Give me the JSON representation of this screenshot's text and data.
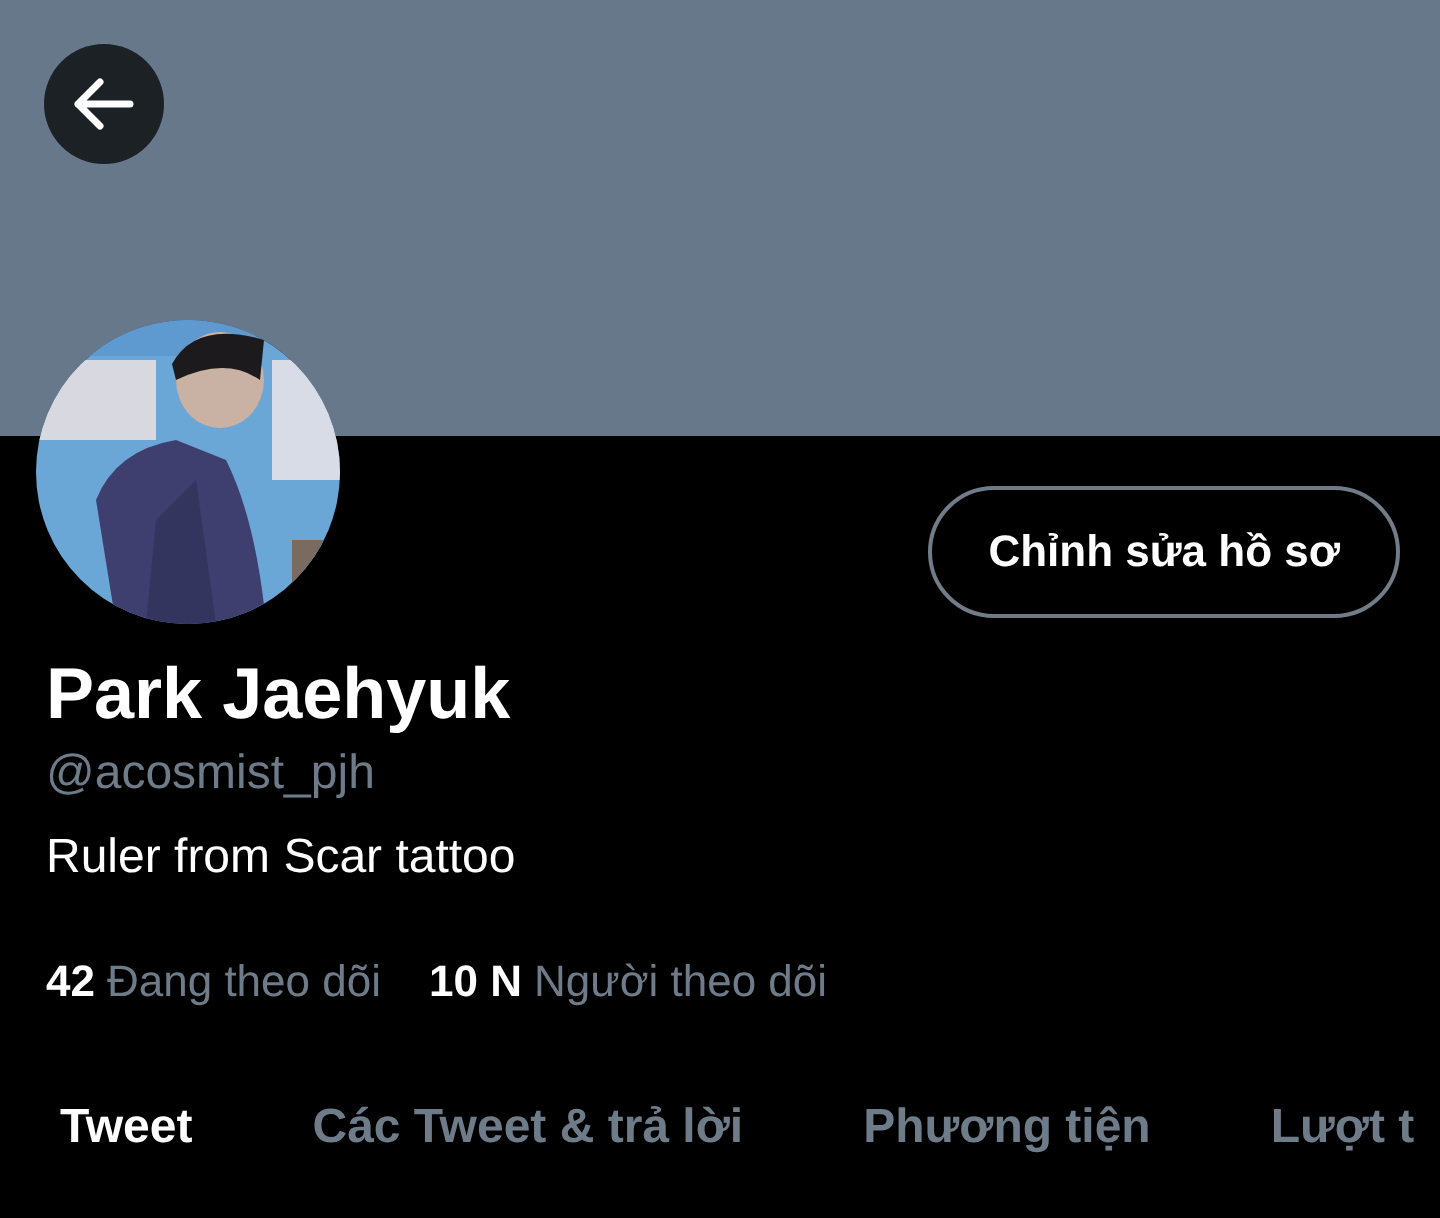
{
  "profile": {
    "name": "Park Jaehyuk",
    "handle": "@acosmist_pjh",
    "bio": "Ruler from Scar tattoo",
    "edit_button": "Chỉnh sửa hồ sơ"
  },
  "stats": [
    {
      "count": "42",
      "label": "Đang theo dõi"
    },
    {
      "count": "10 N",
      "label": "Người theo dõi"
    }
  ],
  "tabs": [
    {
      "label": "Tweet",
      "selected": true
    },
    {
      "label": "Các Tweet & trả lời",
      "selected": false
    },
    {
      "label": "Phương tiện",
      "selected": false
    },
    {
      "label": "Lượt t",
      "selected": false
    }
  ]
}
